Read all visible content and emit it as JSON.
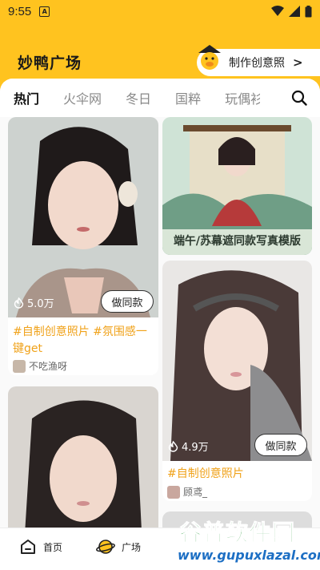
{
  "status": {
    "time": "9:55",
    "badge": "A"
  },
  "header": {
    "title": "妙鸭广场",
    "make_button": "制作创意照",
    "make_chevron": ">"
  },
  "tabs": [
    "热门",
    "火伞网",
    "冬日",
    "国粹",
    "玩偶衫"
  ],
  "cards": {
    "left1": {
      "likes": "5.0万",
      "button": "做同款",
      "caption": "#自制创意照片 #氛围感一键get",
      "author": "不吃渔呀"
    },
    "right1": {
      "banner": "端午/苏幕遮同款写真模版"
    },
    "right2": {
      "likes": "4.9万",
      "button": "做同款",
      "caption": "#自制创意照片",
      "author": "顾鸢_"
    }
  },
  "nav": {
    "home": "首页",
    "plaza": "广场"
  },
  "watermark": {
    "top": "谷普软件园",
    "bottom": "www.gupuxlazal.com"
  },
  "colors": {
    "brand_yellow": "#ffc31f",
    "caption_orange": "#f0a21a"
  }
}
